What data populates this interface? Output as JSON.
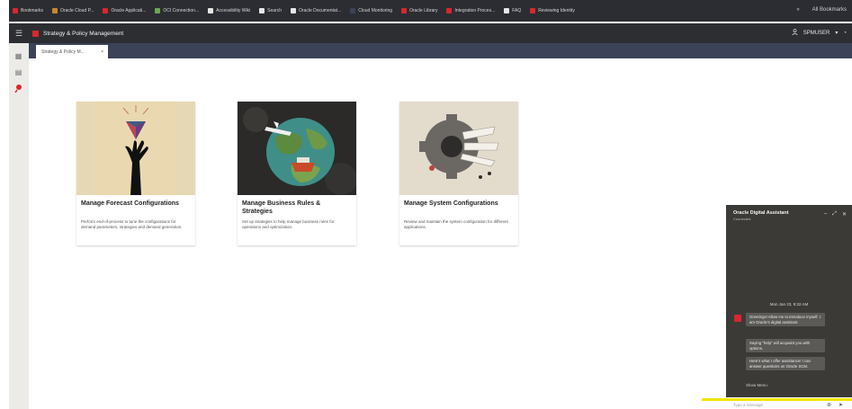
{
  "browser": {
    "bookmarks": [
      {
        "label": "Bookmarks",
        "color": "#d9272e"
      },
      {
        "label": "Oracle Cloud P...",
        "color": "#c9862c"
      },
      {
        "label": "Oracle Applicati...",
        "color": "#d9272e"
      },
      {
        "label": "OCI Connection...",
        "color": "#6aa84f"
      },
      {
        "label": "Accessibility Wiki",
        "color": "#e6e6e6"
      },
      {
        "label": "Search",
        "color": "#e6e6e6"
      },
      {
        "label": "Oracle Documentat...",
        "color": "#e6e6e6"
      },
      {
        "label": "Cloud Monitoring",
        "color": "#3c4358"
      },
      {
        "label": "Oracle Library",
        "color": "#d9272e"
      },
      {
        "label": "Integration Proces...",
        "color": "#d9272e"
      },
      {
        "label": "FAQ",
        "color": "#e6e6e6"
      },
      {
        "label": "Reviewing Identity",
        "color": "#d9272e"
      }
    ],
    "right_label": "All Bookmarks"
  },
  "header": {
    "title": "Strategy & Policy Management",
    "username": "SPMUSER",
    "logo_color": "#d9272e"
  },
  "tabs": [
    {
      "label": "Strategy & Policy M...",
      "close": "×"
    }
  ],
  "cards": [
    {
      "title": "Manage Forecast Configurations",
      "description": "Perform end-of-process to tune the configurations for demand parameters, strategies and demand generation."
    },
    {
      "title": "Manage Business Rules & Strategies",
      "description": "Set up strategies to help manage business rules for operations and optimization."
    },
    {
      "title": "Manage System Configurations",
      "description": "Review and maintain the system configuration for different applications."
    }
  ],
  "assistant": {
    "title": "Oracle Digital Assistant",
    "subtitle": "Connected",
    "timestamp": "Mon Jan 23, 9:32 AM",
    "messages": [
      "Greetings! Allow me to introduce myself. I am Oracle's digital assistant.",
      "Saying \"help\" will acquaint you with options.",
      "Here's what I offer assistance! I can answer questions on Oracle SCM."
    ],
    "menu_label": "Show Menu",
    "input_placeholder": "Type a message"
  },
  "colors": {
    "header_bg": "#2d2e32",
    "tabs_bg": "#3c4358",
    "accent": "#d9272e",
    "highlight": "#f2e600"
  }
}
